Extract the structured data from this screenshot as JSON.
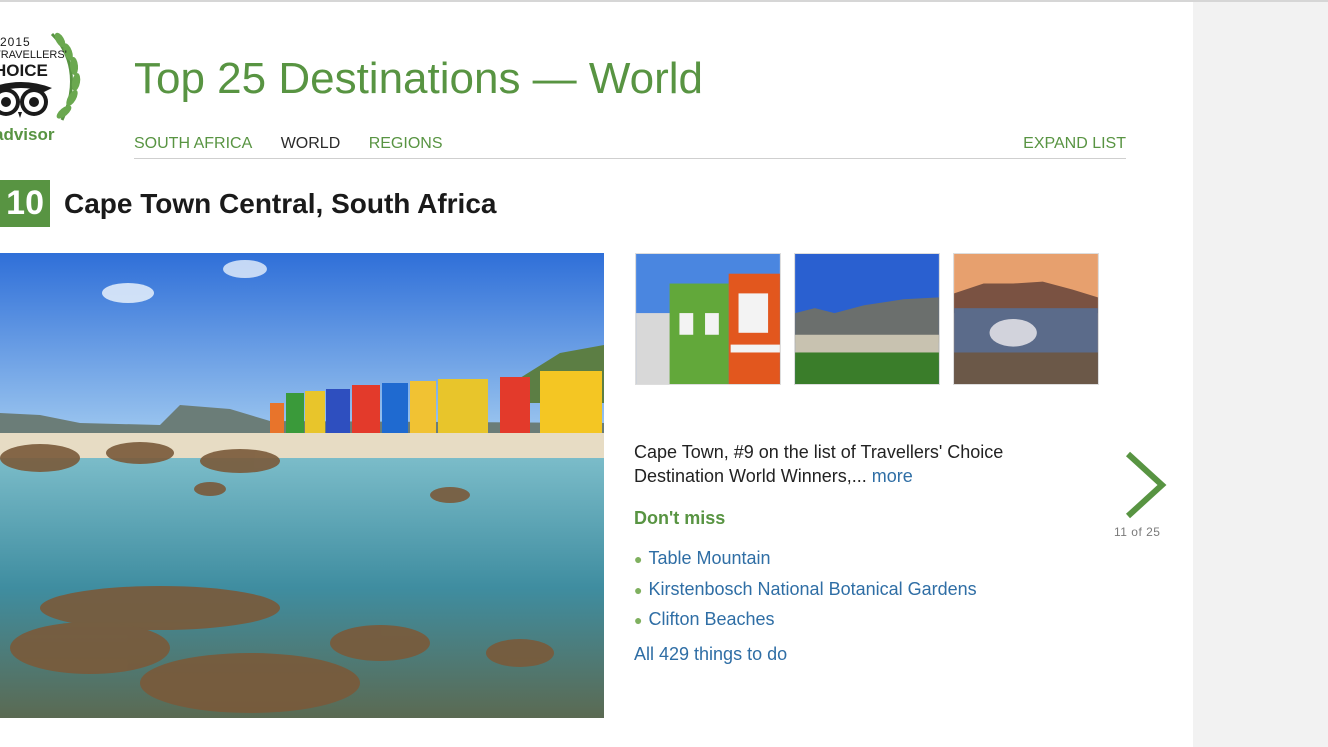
{
  "logo": {
    "year": "2015",
    "line1": "TRAVELLERS'",
    "line2": "HOICE",
    "brand": "advisor"
  },
  "header": {
    "title": "Top 25 Destinations — World"
  },
  "nav": {
    "items": [
      {
        "label": "SOUTH AFRICA",
        "active": false
      },
      {
        "label": "WORLD",
        "active": true
      },
      {
        "label": "REGIONS",
        "active": false
      }
    ],
    "expand_label": "EXPAND LIST"
  },
  "destination": {
    "rank": "10",
    "title": "Cape Town Central, South Africa",
    "description": "Cape Town, #9 on the list of Travellers' Choice Destination World Winners,...",
    "more_label": "more",
    "dont_miss_heading": "Don't miss",
    "attractions": [
      "Table Mountain",
      "Kirstenbosch National Botanical Gardens",
      "Clifton Beaches"
    ],
    "all_things_label": "All 429 things to do"
  },
  "pager": {
    "counter": "11 of 25",
    "next_icon": "chevron-right-icon"
  },
  "colors": {
    "brand_green": "#589442",
    "link_blue": "#2f6ea5",
    "side_panel": "#f2f2f2"
  }
}
